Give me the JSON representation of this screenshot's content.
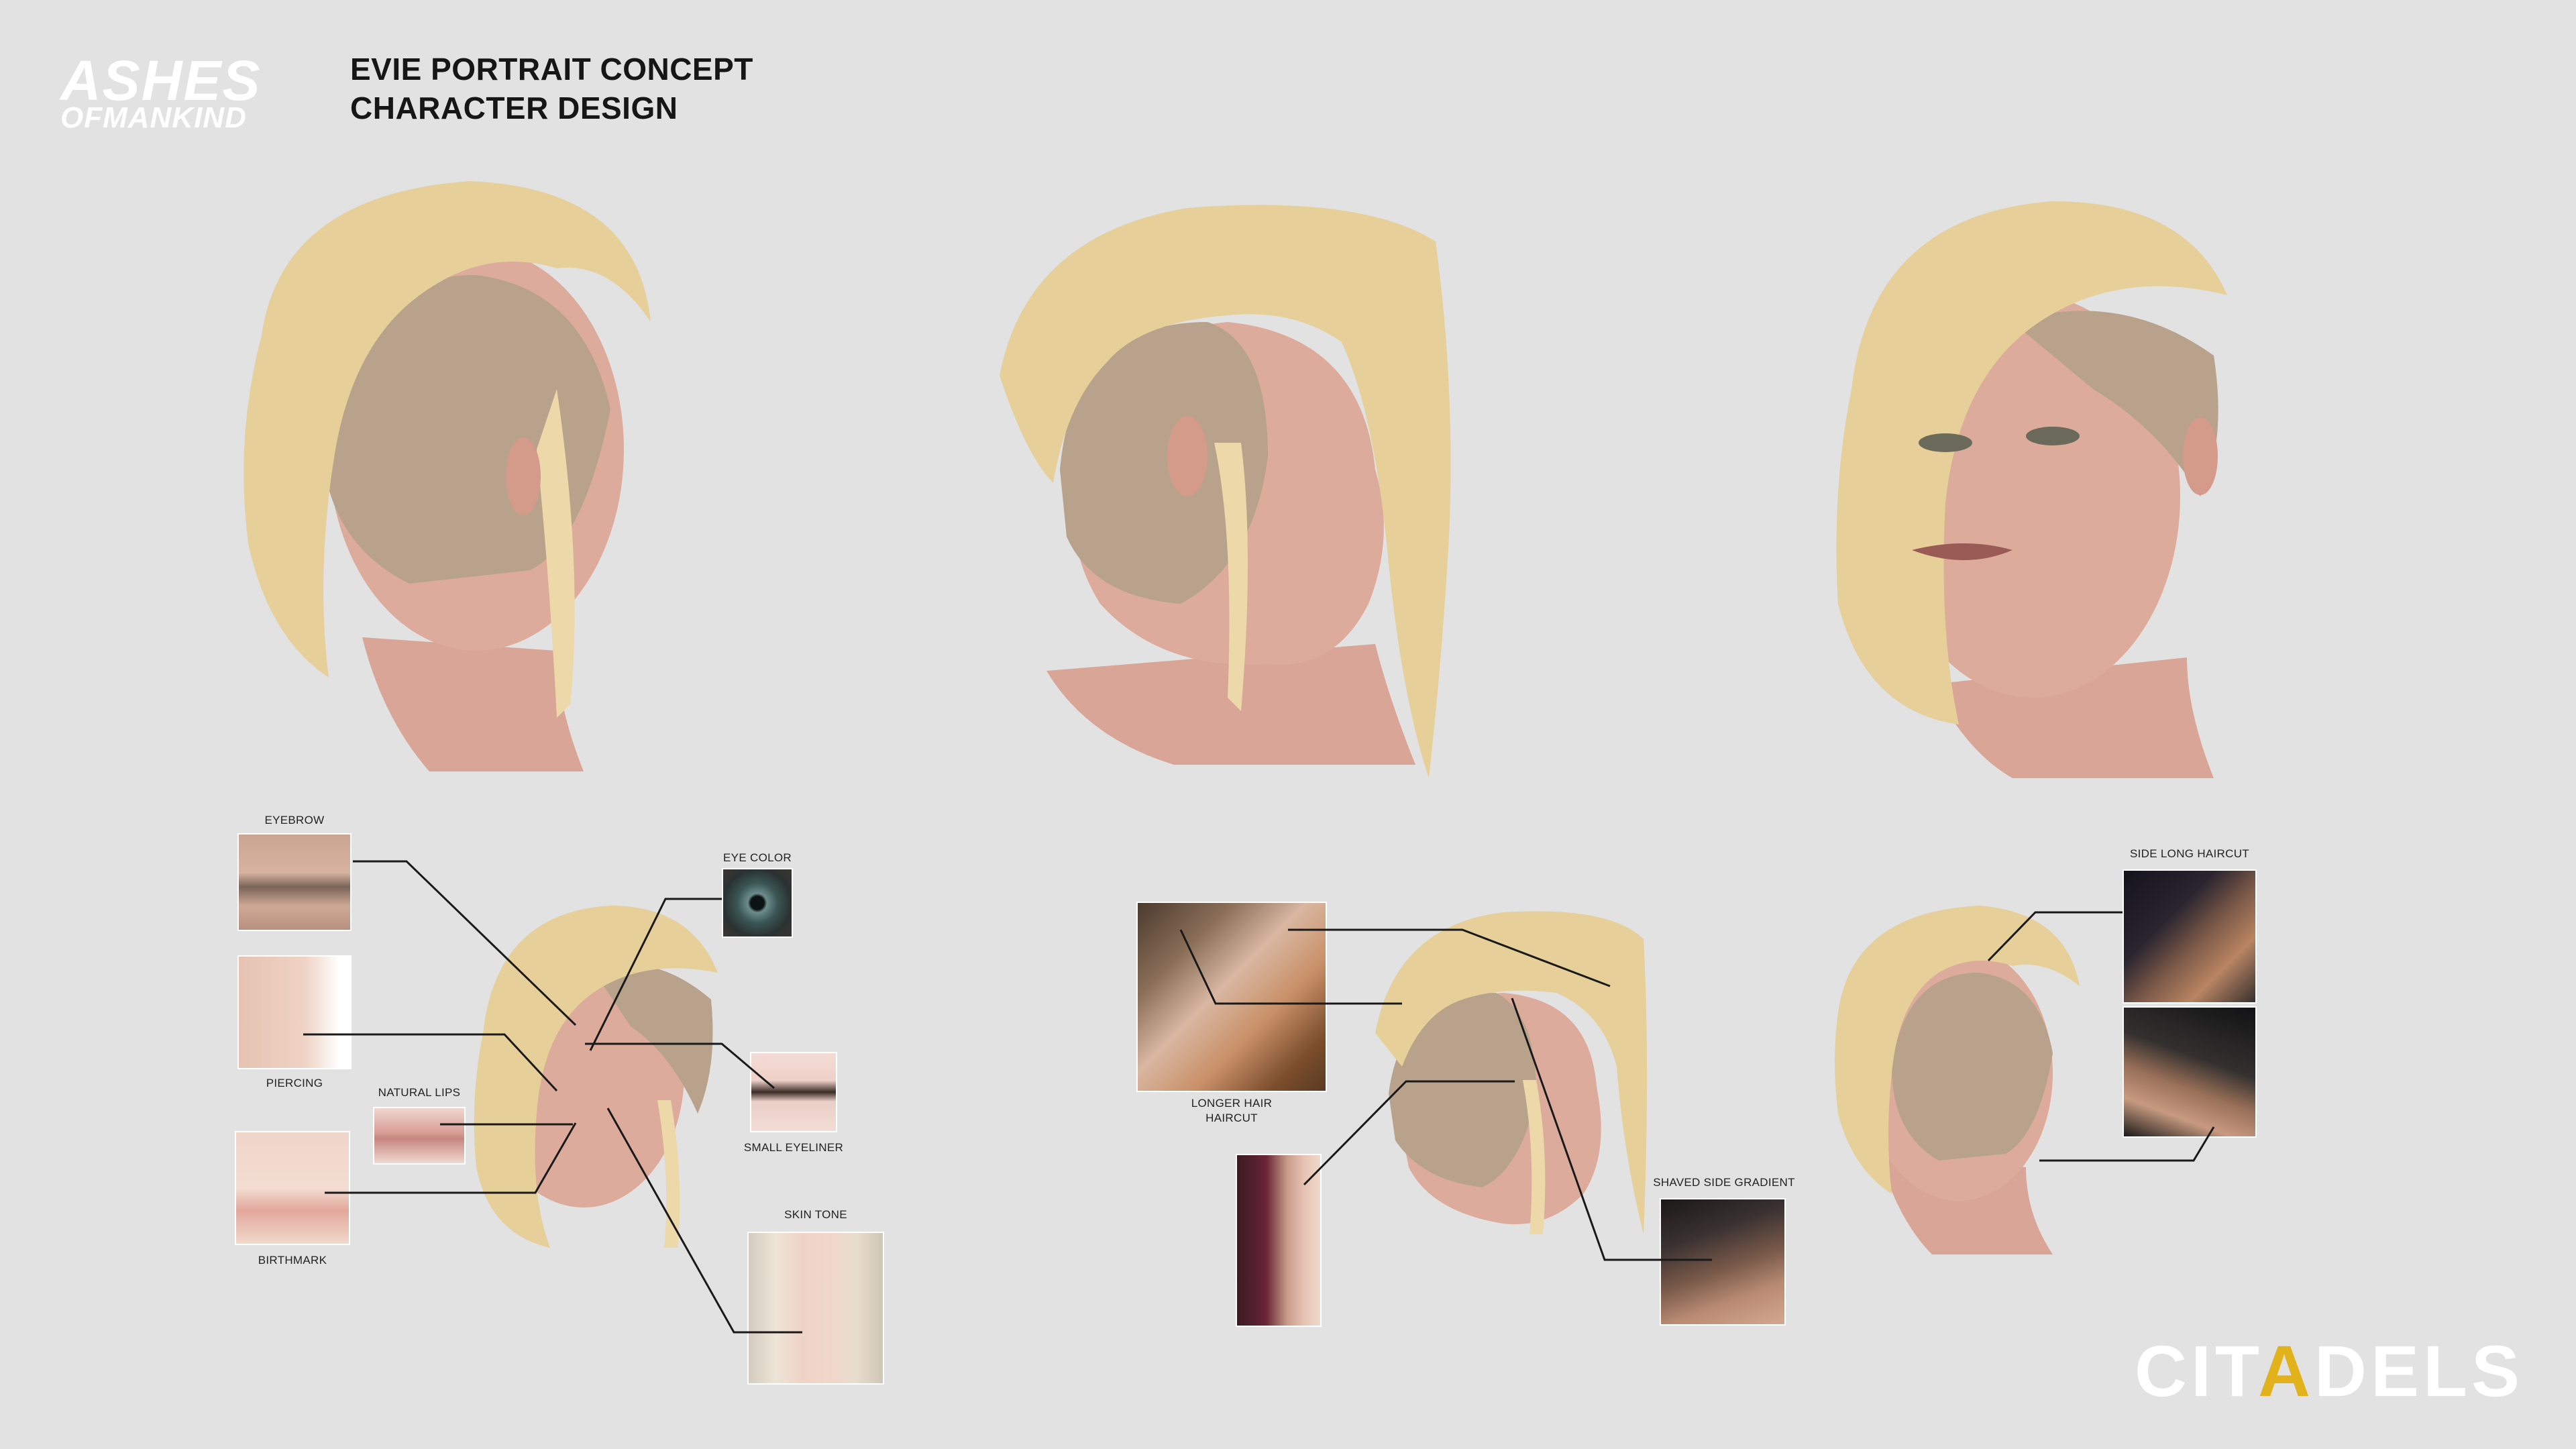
{
  "header": {
    "logo_line1": "ASHES",
    "logo_line2": "OFMANKIND",
    "title_line1": "EVIE PORTRAIT CONCEPT",
    "title_line2": "CHARACTER DESIGN"
  },
  "references_left": {
    "eyebrow": "EYEBROW",
    "eye_color": "EYE COLOR",
    "piercing": "PIERCING",
    "natural_lips": "NATURAL LIPS",
    "small_eyeliner": "SMALL EYELINER",
    "skin_tone": "SKIN TONE",
    "birthmark": "BIRTHMARK"
  },
  "references_right": {
    "longer_hair_line1": "LONGER HAIR",
    "longer_hair_line2": "HAIRCUT",
    "shaved_side_gradient": "SHAVED SIDE GRADIENT",
    "side_long_haircut": "SIDE LONG HAIRCUT"
  },
  "footer": {
    "brand_part1": "CIT",
    "brand_part2": "A",
    "brand_part3": "DELS"
  },
  "colors": {
    "background": "#e2e2e2",
    "hair": "#e6cf98",
    "skin": "#dba99a",
    "shaved": "#b8a28c",
    "accent": "#e1b21b"
  }
}
